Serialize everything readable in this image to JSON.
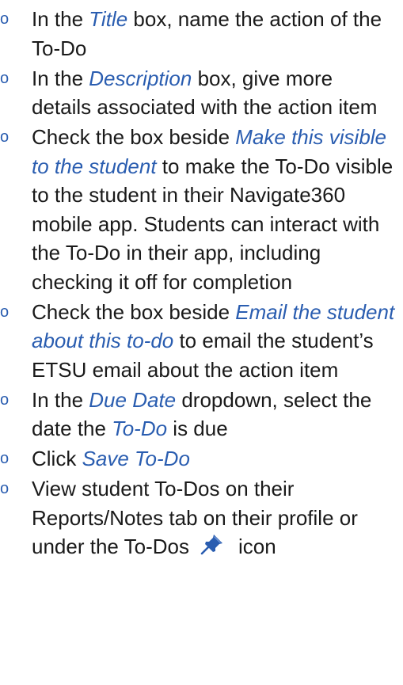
{
  "colors": {
    "accent": "#2a5db0",
    "text": "#1a1a1a",
    "background": "#ffffff"
  },
  "bullet_glyph": "o",
  "items": [
    {
      "pre": "In the ",
      "emph": "Title",
      "post": " box, name the action of the To-Do"
    },
    {
      "pre": "In the ",
      "emph": "Description",
      "post": " box, give more details associated with the action item"
    },
    {
      "pre": "Check the box beside ",
      "emph": "Make this visible to the student",
      "post": " to make the To-Do visible to the student in their Navigate360 mobile app. Students can interact with the To-Do in their app, including checking it off for completion"
    },
    {
      "pre": "Check the box beside ",
      "emph": "Email the student about this to-do",
      "post": " to email the student’s ETSU email about the action item"
    },
    {
      "pre": "In the ",
      "emph": "Due Date",
      "mid": " dropdown, select the date the ",
      "emph2": "To-Do",
      "post": " is due"
    },
    {
      "pre": "Click ",
      "emph": "Save To-Do",
      "post": ""
    },
    {
      "pre": "View student To-Dos on their Reports/Notes tab on their profile or under the To-Dos",
      "icon": "pushpin-icon",
      "post": "icon"
    }
  ]
}
